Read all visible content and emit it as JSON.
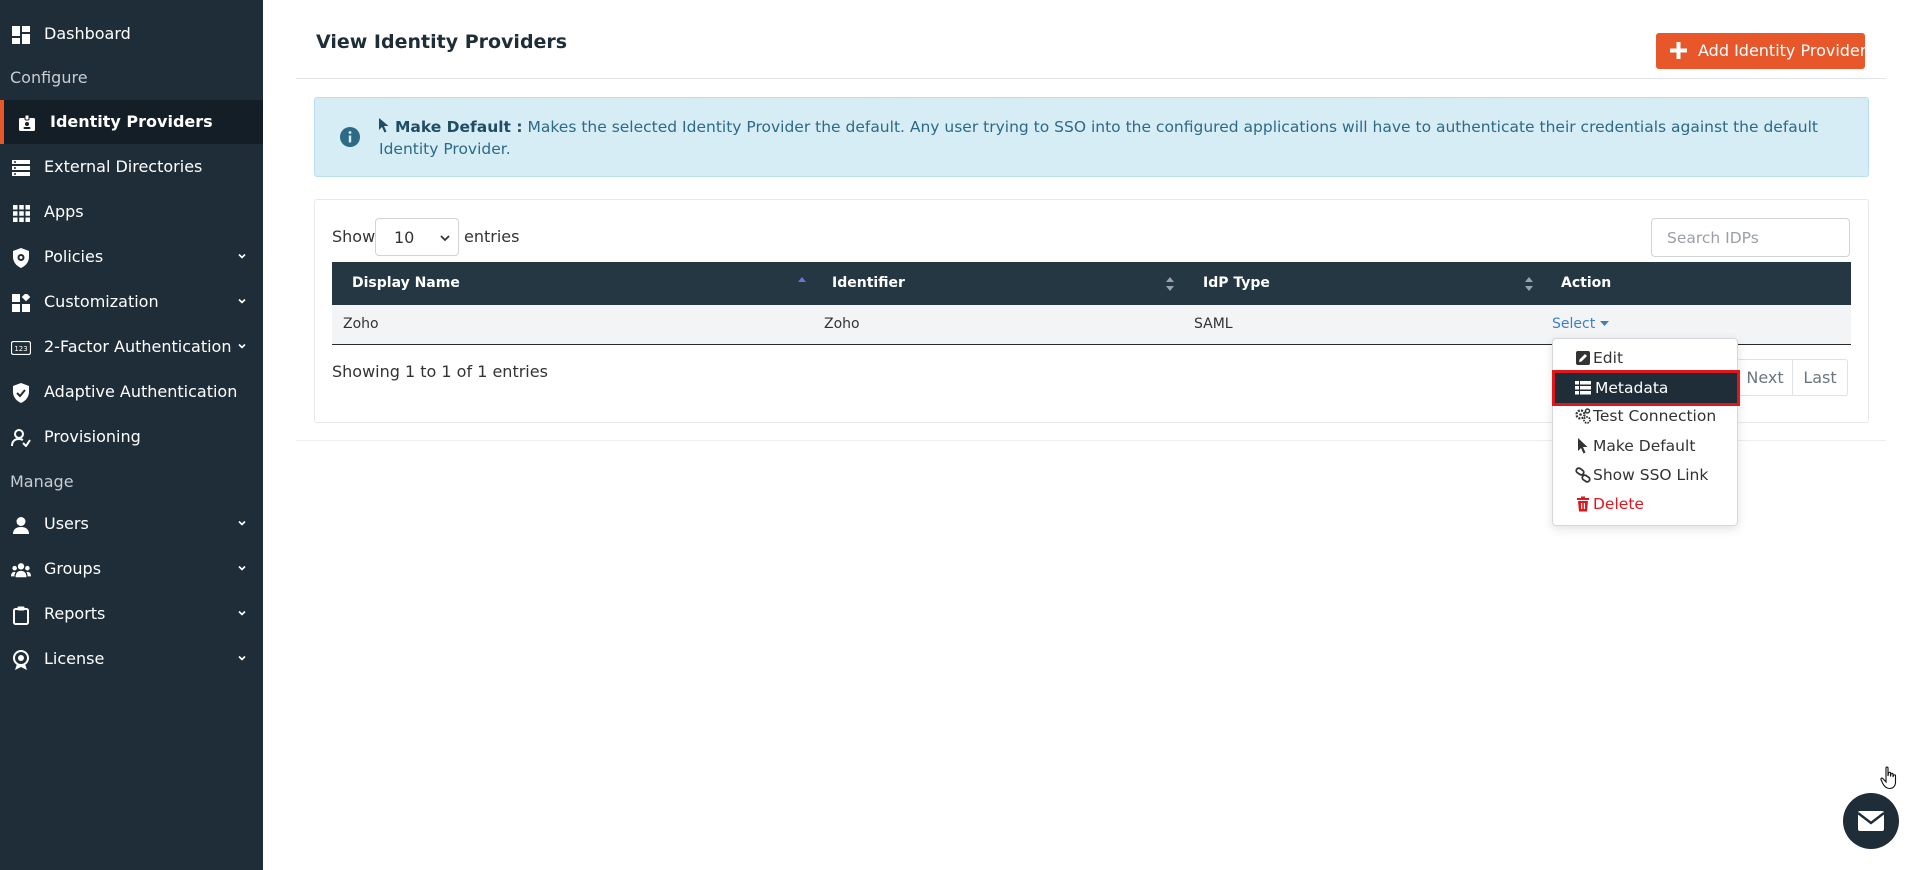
{
  "sidebar": {
    "items": [
      {
        "label": "Dashboard",
        "icon": "dashboard-icon"
      },
      {
        "label": "Identity Providers",
        "icon": "idp-icon",
        "active": true
      },
      {
        "label": "External Directories",
        "icon": "directories-icon"
      },
      {
        "label": "Apps",
        "icon": "apps-grid-icon"
      },
      {
        "label": "Policies",
        "icon": "shield-gear-icon"
      },
      {
        "label": "Customization",
        "icon": "customization-icon"
      },
      {
        "label": "2-Factor Authentication",
        "icon": "2fa-icon"
      },
      {
        "label": "Adaptive Authentication",
        "icon": "shield-check-icon"
      },
      {
        "label": "Provisioning",
        "icon": "provisioning-icon"
      },
      {
        "label": "Users",
        "icon": "user-icon"
      },
      {
        "label": "Groups",
        "icon": "groups-icon"
      },
      {
        "label": "Reports",
        "icon": "clipboard-icon"
      },
      {
        "label": "License",
        "icon": "badge-icon"
      }
    ],
    "sections": {
      "configure": "Configure",
      "manage": "Manage"
    }
  },
  "header": {
    "title": "View Identity Providers",
    "add_button": "Add Identity Provider"
  },
  "alert": {
    "title": "Make Default :",
    "text": " Makes the selected Identity Provider the default. Any user trying to SSO into the configured applications will have to authenticate their credentials against the default Identity Provider."
  },
  "table": {
    "show_label": "Show",
    "page_length": "10",
    "entries_label": "entries",
    "search_placeholder": "Search IDPs",
    "columns": [
      "Display Name",
      "Identifier",
      "IdP Type",
      "Action"
    ],
    "rows": [
      {
        "display_name": "Zoho",
        "identifier": "Zoho",
        "idp_type": "SAML",
        "action": "Select"
      }
    ],
    "info": "Showing 1 to 1 of 1 entries",
    "pager": {
      "next": "Next",
      "last": "Last"
    }
  },
  "dropdown": {
    "items": [
      {
        "label": "Edit",
        "icon": "edit-icon"
      },
      {
        "label": "Metadata",
        "icon": "table-icon"
      },
      {
        "label": "Test Connection",
        "icon": "gears-icon"
      },
      {
        "label": "Make Default",
        "icon": "pointer-icon"
      },
      {
        "label": "Show SSO Link",
        "icon": "link-icon"
      },
      {
        "label": "Delete",
        "icon": "trash-icon"
      }
    ]
  },
  "colors": {
    "sidebar_bg": "#1f2d38",
    "accent": "#e8572a",
    "table_header": "#253743",
    "alert_bg": "#d7edf6",
    "danger": "#e0161e"
  }
}
